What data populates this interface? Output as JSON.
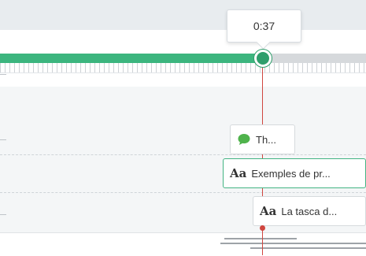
{
  "playhead": {
    "time_label": "0:37",
    "progress_fraction": 0.71
  },
  "colors": {
    "progress": "#3cb57e",
    "playhead": "#d0463f",
    "selected_border": "#43b483",
    "chat_icon": "#4fb34c"
  },
  "tracks": {
    "clips": [
      {
        "icon": "chat-bubble-icon",
        "label": "Th..."
      },
      {
        "icon": "text-aa-icon",
        "icon_text": "Aa",
        "label": "Exemples de pr..."
      },
      {
        "icon": "text-aa-icon",
        "icon_text": "Aa",
        "label": "La tasca d..."
      }
    ]
  }
}
